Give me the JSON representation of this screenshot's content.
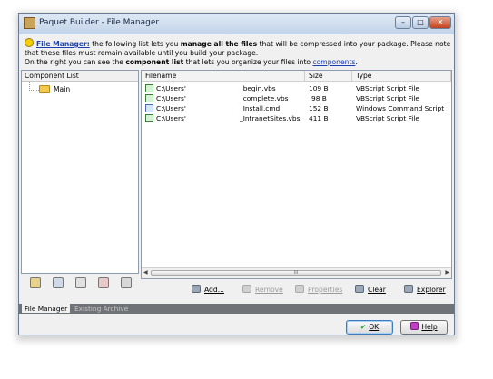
{
  "window": {
    "title": "Paquet Builder - File Manager",
    "controls": [
      "minimize",
      "maximize",
      "close"
    ]
  },
  "info": {
    "link_label": "File Manager:",
    "text1": " the following list lets you ",
    "bold1": "manage all the files",
    "text2": " that will be compressed into your package. Please note that these files must remain available until you build your package.",
    "line2_text": "On the right you can see the ",
    "bold2": "component list",
    "line2_text2": " that lets you organize your files into ",
    "link2": "components",
    "end": "."
  },
  "component_list": {
    "header": "Component List",
    "items": [
      {
        "label": "Main"
      }
    ]
  },
  "file_list": {
    "columns": {
      "filename": "Filename",
      "size": "Size",
      "type": "Type"
    },
    "rows": [
      {
        "path": "C:\\Users'",
        "name": "_begin.vbs",
        "size": "109 B",
        "type": "VBScript Script File",
        "icon": "vbs-file-icon"
      },
      {
        "path": "C:\\Users'",
        "name": "_complete.vbs",
        "size": "98 B",
        "type": "VBScript Script File",
        "icon": "vbs-file-icon"
      },
      {
        "path": "C:\\Users'",
        "name": "_Install.cmd",
        "size": "152 B",
        "type": "Windows Command Script",
        "icon": "cmd-file-icon"
      },
      {
        "path": "C:\\Users'",
        "name": "_IntranetSites.vbs",
        "size": "411 B",
        "type": "VBScript Script File",
        "icon": "vbs-file-icon"
      }
    ],
    "scrollbar_grip": "III"
  },
  "actions": {
    "add": "Add...",
    "remove": "Remove",
    "properties": "Properties",
    "clear": "Clear",
    "explorer": "Explorer"
  },
  "tabs": [
    "File Manager",
    "Existing Archive"
  ],
  "buttons": {
    "ok": "OK",
    "help": "Help"
  },
  "colors": {
    "titlebar": "#c3d4e9",
    "tabbar": "#6f7276",
    "link": "#1a3fb0"
  }
}
